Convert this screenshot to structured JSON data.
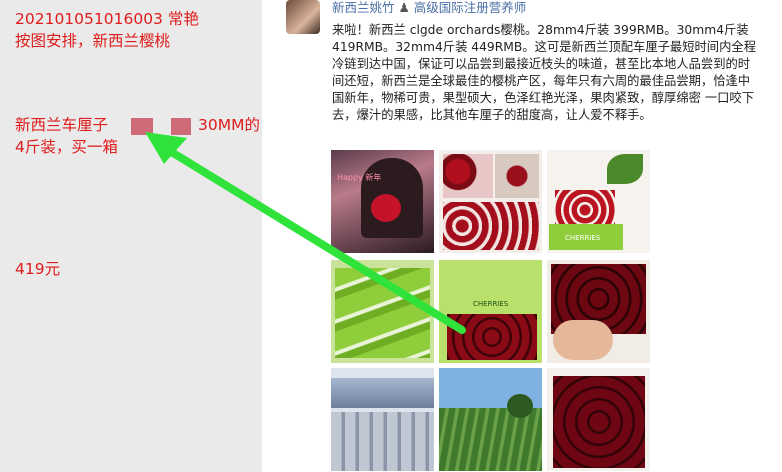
{
  "annotation": {
    "line1": "202101051016003   常艳",
    "line2": "按图安排，新西兰樱桃",
    "line3_prefix": "新西兰车厘子",
    "line3_suffix": "30MM的",
    "line4": "4斤装，买一箱",
    "price": "419元",
    "text_color": "#e01b1b",
    "arrow_color": "#2fe33a"
  },
  "post": {
    "author": "新西兰姚竹",
    "author_icon": "chef-icon",
    "author_title": "高级国际注册营养师",
    "body_text": "来啦！新西兰 clgde orchards樱桃。28mm4斤装 399RMB。30mm4斤装 419RMB。32mm4斤装 449RMB。这可是新西兰顶配车厘子最短时间内全程冷链到达中国，保证可以品尝到最接近枝头的味道，甚至比本地人品尝到的时间还短，新西兰是全球最佳的樱桃产区，每年只有六周的最佳品尝期，恰逢中国新年，物稀可贵，果型硕大，色泽红艳光泽，果肉紧致，醇厚绵密 一口咬下去，爆汁的果感，比其他车厘子的甜度高，让人爱不释手。",
    "name_color": "#4a6fa5"
  },
  "grid": {
    "tiles": [
      {
        "label": "woman-holding-cherry-photo",
        "caption": "Happy 新年"
      },
      {
        "label": "cherry-boxes-collage-photo",
        "caption": ""
      },
      {
        "label": "cherries-on-branch-photo",
        "caption": "CHERRIES"
      },
      {
        "label": "green-cherry-boxes-photo",
        "caption": ""
      },
      {
        "label": "cherry-box-photo",
        "caption": "CHERRIES"
      },
      {
        "label": "cherries-in-hand-photo",
        "caption": ""
      },
      {
        "label": "packing-line-photo",
        "caption": ""
      },
      {
        "label": "orchard-landscape-photo",
        "caption": ""
      },
      {
        "label": "cherries-in-box-photo",
        "caption": ""
      }
    ]
  }
}
